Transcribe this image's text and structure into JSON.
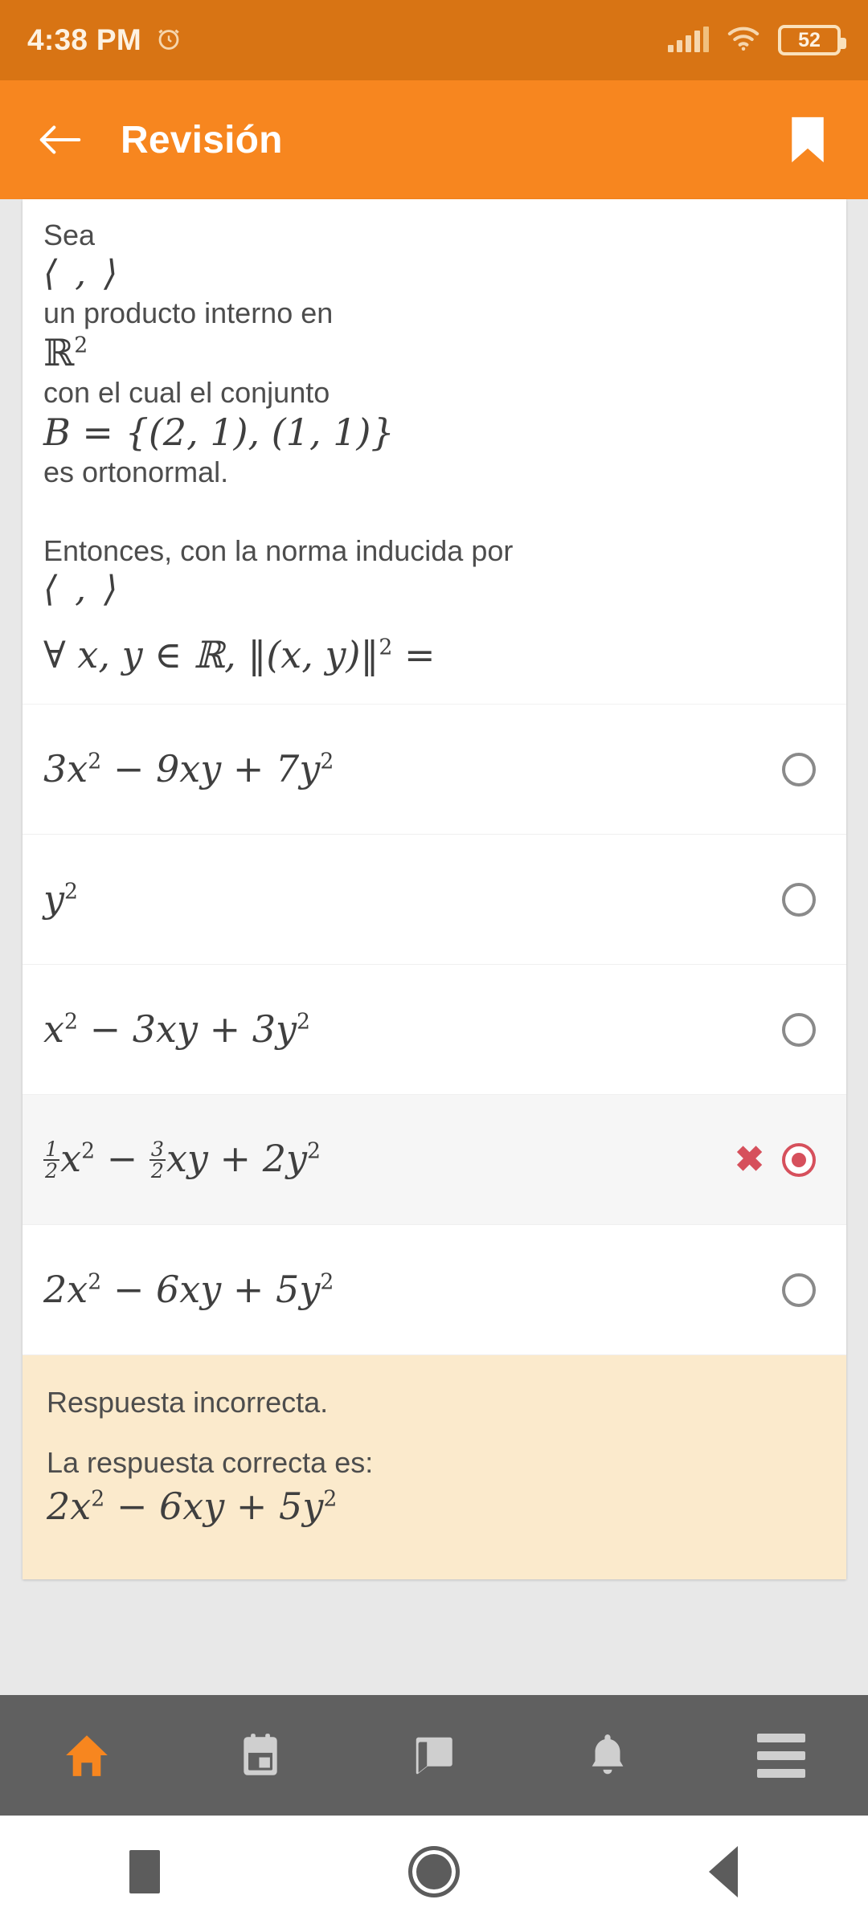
{
  "status_bar": {
    "time": "4:38 PM",
    "alarm_icon": "alarm-clock-icon",
    "signal_icon": "cellular-signal-icon",
    "wifi_icon": "wifi-icon",
    "battery_level": "52"
  },
  "app_bar": {
    "back_icon": "back-arrow-icon",
    "title": "Revisión",
    "bookmark_icon": "bookmark-icon"
  },
  "question": {
    "line1": "Sea",
    "inner_product_1": "⟨ , ⟩",
    "line2": "un producto interno en",
    "space_R2": "ℝ",
    "space_R2_exp": "2",
    "line3": "con el cual el conjunto",
    "set_B": "B = {(2, 1), (1, 1)}",
    "line4": "es ortonormal.",
    "line5": "Entonces, con la norma inducida por",
    "inner_product_2": "⟨ , ⟩",
    "norm_expression": "∀ x, y ∈ ℝ,  ‖(x, y)‖",
    "norm_exponent": "2",
    "norm_equals": "="
  },
  "options": [
    {
      "id": "option-1",
      "text": "3x² − 9xy + 7y²",
      "parts": {
        "a_coef": "3",
        "a_var": "x",
        "a_exp": "2",
        "op1": "−",
        "b_coef": "9",
        "b_var": "xy",
        "op2": "+",
        "c_coef": "7",
        "c_var": "y",
        "c_exp": "2"
      },
      "selected": false,
      "has_fractions": false
    },
    {
      "id": "option-2",
      "text": "y²",
      "parts": {
        "c_var": "y",
        "c_exp": "2"
      },
      "selected": false,
      "has_fractions": false
    },
    {
      "id": "option-3",
      "text": "x² − 3xy + 3y²",
      "parts": {
        "a_coef": "",
        "a_var": "x",
        "a_exp": "2",
        "op1": "−",
        "b_coef": "3",
        "b_var": "xy",
        "op2": "+",
        "c_coef": "3",
        "c_var": "y",
        "c_exp": "2"
      },
      "selected": false,
      "has_fractions": false
    },
    {
      "id": "option-4",
      "text": "½x² − 3/2 xy + 2y²",
      "parts": {
        "f1_num": "1",
        "f1_den": "2",
        "a_var": "x",
        "a_exp": "2",
        "op1": "−",
        "f2_num": "3",
        "f2_den": "2",
        "b_var": "xy",
        "op2": "+",
        "c_coef": "2",
        "c_var": "y",
        "c_exp": "2"
      },
      "selected": true,
      "has_fractions": true,
      "mark_icon": "incorrect-x-icon"
    },
    {
      "id": "option-5",
      "text": "2x² − 6xy + 5y²",
      "parts": {
        "a_coef": "2",
        "a_var": "x",
        "a_exp": "2",
        "op1": "−",
        "b_coef": "6",
        "b_var": "xy",
        "op2": "+",
        "c_coef": "5",
        "c_var": "y",
        "c_exp": "2"
      },
      "selected": false,
      "has_fractions": false
    }
  ],
  "feedback": {
    "result": "Respuesta incorrecta.",
    "correct_label": "La respuesta correcta es:",
    "correct_answer": "2x² − 6xy + 5y²",
    "parts": {
      "a_coef": "2",
      "a_var": "x",
      "a_exp": "2",
      "op1": "−",
      "b_coef": "6",
      "b_var": "xy",
      "op2": "+",
      "c_coef": "5",
      "c_var": "y",
      "c_exp": "2"
    }
  },
  "bottom_nav": [
    {
      "id": "nav-home",
      "icon": "home-icon",
      "active": true
    },
    {
      "id": "nav-calendar",
      "icon": "calendar-icon",
      "active": false
    },
    {
      "id": "nav-messages",
      "icon": "message-icon",
      "active": false
    },
    {
      "id": "nav-notifications",
      "icon": "bell-icon",
      "active": false
    },
    {
      "id": "nav-menu",
      "icon": "hamburger-menu-icon",
      "active": false
    }
  ],
  "system_nav": [
    {
      "id": "recents-button",
      "icon": "square-recents-icon"
    },
    {
      "id": "home-button",
      "icon": "circle-home-icon"
    },
    {
      "id": "back-button",
      "icon": "triangle-back-icon"
    }
  ],
  "colors": {
    "status_bar": "#d87414",
    "app_bar": "#f7861f",
    "accent": "#f7861f",
    "incorrect": "#d6505c",
    "feedback_bg": "#fbeacc",
    "page_bg": "#e8e8e8",
    "nav_bg": "#606060"
  }
}
